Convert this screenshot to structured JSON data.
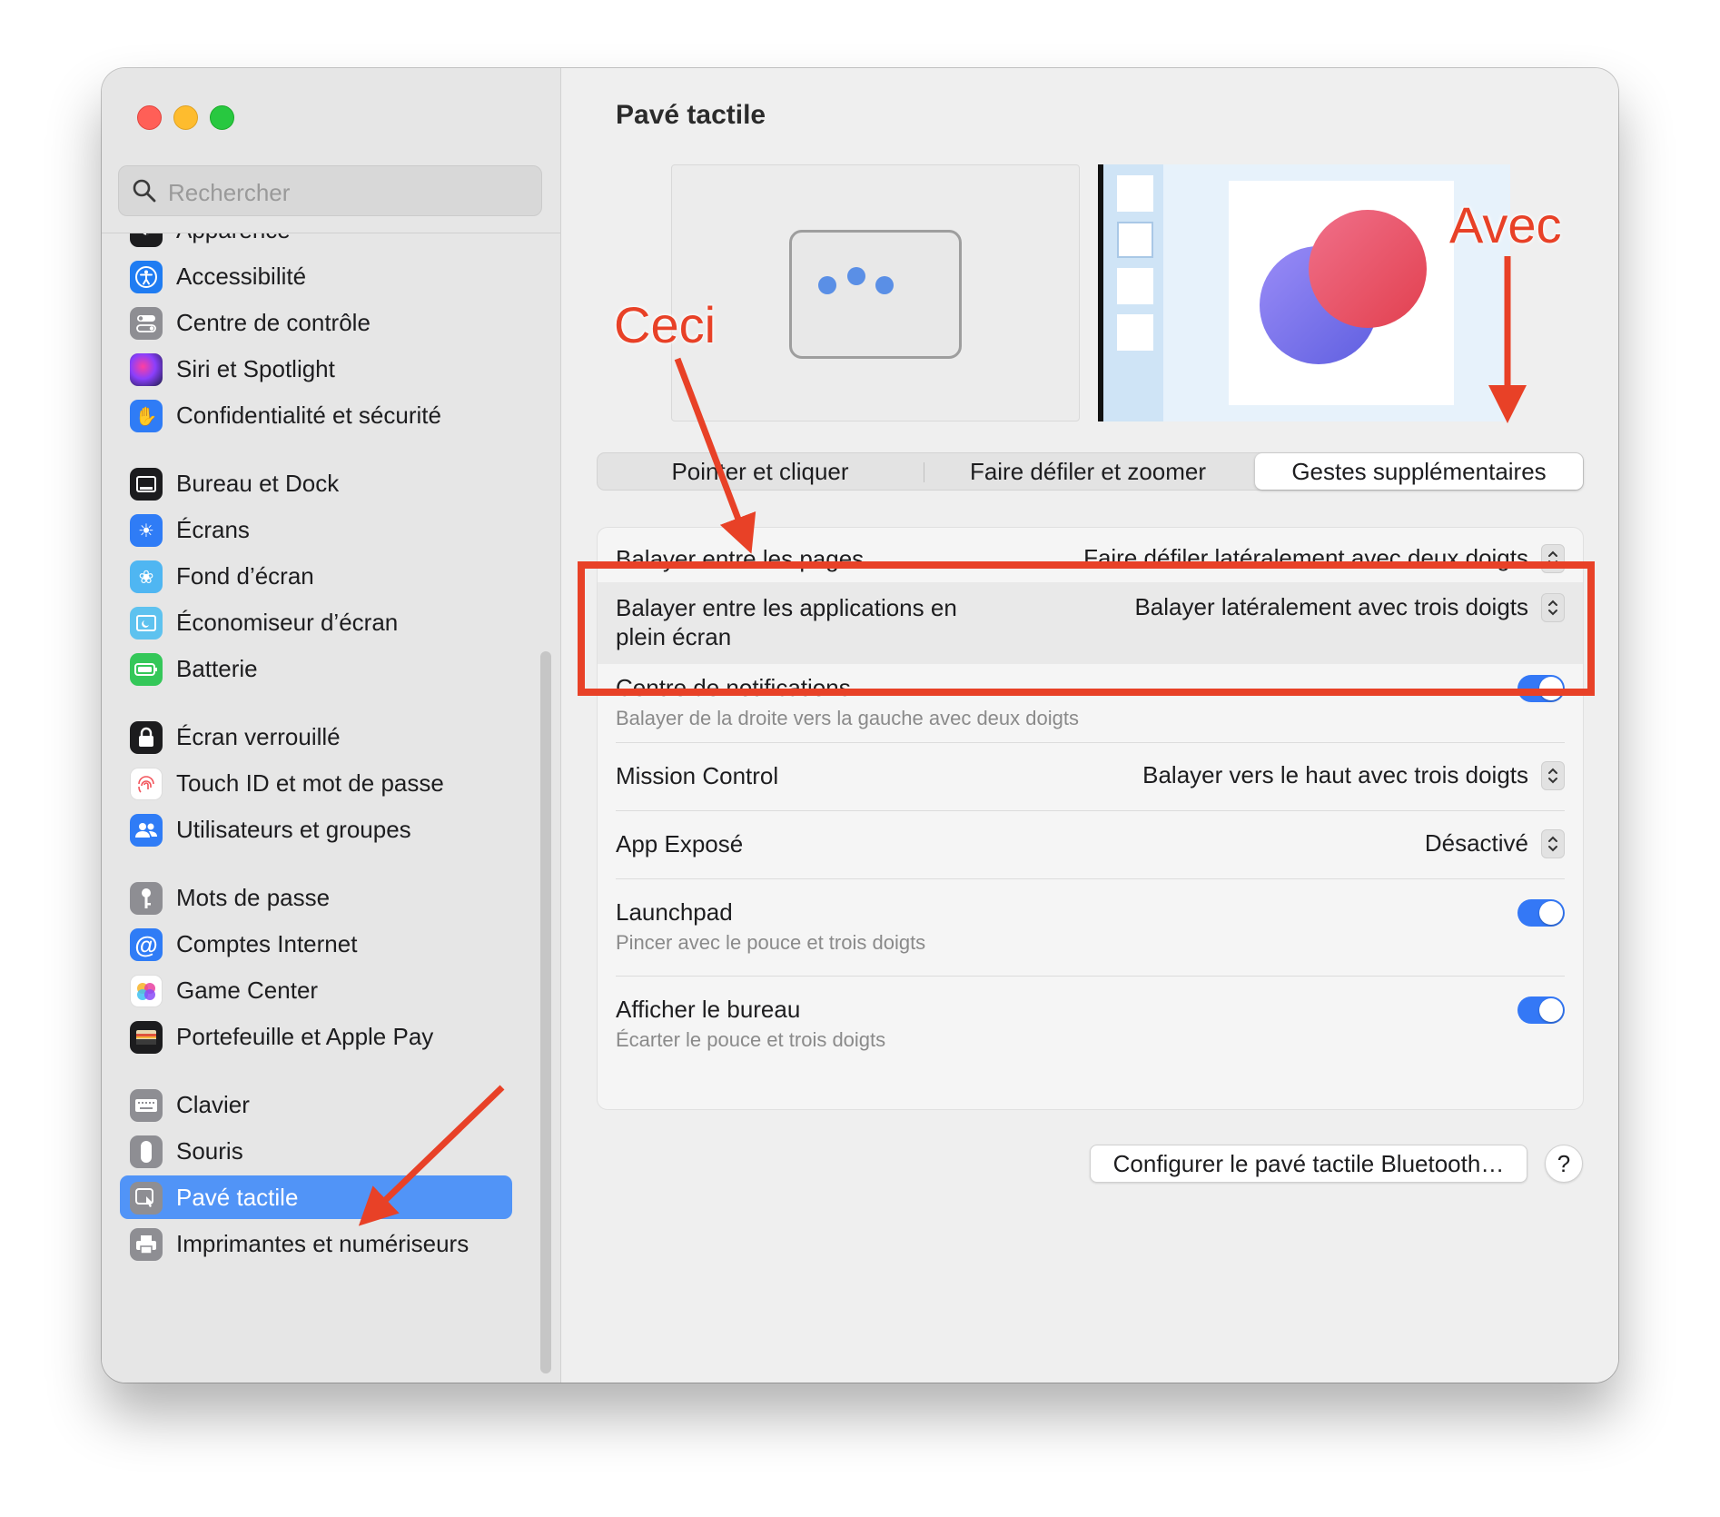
{
  "window": {
    "title": "Pavé tactile"
  },
  "sidebar": {
    "search_placeholder": "Rechercher",
    "items": [
      {
        "label": "Apparence",
        "icon": "appearance-icon",
        "color": "#1c1c1e"
      },
      {
        "label": "Accessibilité",
        "icon": "accessibility-icon",
        "color": "#1f7cf2"
      },
      {
        "label": "Centre de contrôle",
        "icon": "control-center-icon",
        "color": "#8e8e93"
      },
      {
        "label": "Siri et Spotlight",
        "icon": "siri-icon",
        "color": "#8a3ffc"
      },
      {
        "label": "Confidentialité et sécurité",
        "icon": "hand-icon",
        "color": "#2f7cf6"
      },
      {
        "label": "Bureau et Dock",
        "icon": "dock-icon",
        "color": "#1c1c1e"
      },
      {
        "label": "Écrans",
        "icon": "sun-icon",
        "color": "#2f7cf6"
      },
      {
        "label": "Fond d’écran",
        "icon": "flower-icon",
        "color": "#4fb6f2"
      },
      {
        "label": "Économiseur d’écran",
        "icon": "screensaver-icon",
        "color": "#5ec2ef"
      },
      {
        "label": "Batterie",
        "icon": "battery-icon",
        "color": "#34c759"
      },
      {
        "label": "Écran verrouillé",
        "icon": "lock-icon",
        "color": "#1c1c1e"
      },
      {
        "label": "Touch ID et mot de passe",
        "icon": "fingerprint-icon",
        "color": "#ffffff"
      },
      {
        "label": "Utilisateurs et groupes",
        "icon": "users-icon",
        "color": "#2f7cf6"
      },
      {
        "label": "Mots de passe",
        "icon": "key-icon",
        "color": "#8e8e93"
      },
      {
        "label": "Comptes Internet",
        "icon": "at-icon",
        "color": "#2f7cf6"
      },
      {
        "label": "Game Center",
        "icon": "game-center-icon",
        "color": "#ffffff"
      },
      {
        "label": "Portefeuille et Apple Pay",
        "icon": "wallet-icon",
        "color": "#1c1c1e"
      },
      {
        "label": "Clavier",
        "icon": "keyboard-icon",
        "color": "#8e8e93"
      },
      {
        "label": "Souris",
        "icon": "mouse-icon",
        "color": "#8e8e93"
      },
      {
        "label": "Pavé tactile",
        "icon": "trackpad-icon",
        "color": "#8e8e93",
        "selected": true
      },
      {
        "label": "Imprimantes et numériseurs",
        "icon": "printer-icon",
        "color": "#8e8e93"
      }
    ]
  },
  "main": {
    "tabs": [
      {
        "label": "Pointer et cliquer"
      },
      {
        "label": "Faire défiler et zoomer"
      },
      {
        "label": "Gestes supplémentaires",
        "active": true
      }
    ],
    "rows": [
      {
        "label": "Balayer entre les pages",
        "value": "Faire défiler latéralement avec deux doigts",
        "control": "popup"
      },
      {
        "label": "Balayer entre les applications en plein écran",
        "value": "Balayer latéralement avec trois doigts",
        "control": "popup"
      },
      {
        "label": "Centre de notifications",
        "sub": "Balayer de la droite vers la gauche avec deux doigts",
        "control": "toggle",
        "on": true
      },
      {
        "label": "Mission Control",
        "value": "Balayer vers le haut avec trois doigts",
        "control": "popup"
      },
      {
        "label": "App Exposé",
        "value": "Désactivé",
        "control": "popup"
      },
      {
        "label": "Launchpad",
        "sub": "Pincer avec le pouce et trois doigts",
        "control": "toggle",
        "on": true
      },
      {
        "label": "Afficher le bureau",
        "sub": "Écarter le pouce et trois doigts",
        "control": "toggle",
        "on": true
      }
    ],
    "bluetooth_button": "Configurer le pavé tactile Bluetooth…",
    "help_button": "?"
  },
  "annotations": {
    "ceci": "Ceci",
    "avec": "Avec",
    "color": "#e84127"
  },
  "colors": {
    "accent": "#3478f6",
    "selection": "#5194f7",
    "annotation": "#e84127"
  }
}
